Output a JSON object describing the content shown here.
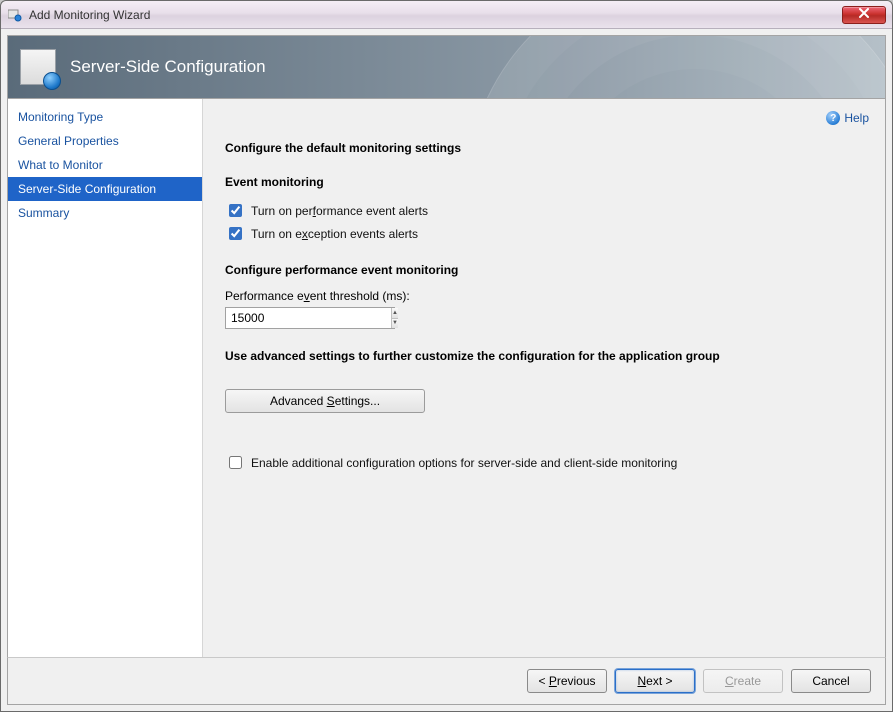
{
  "window": {
    "title": "Add Monitoring Wizard"
  },
  "banner": {
    "heading": "Server-Side Configuration"
  },
  "help": {
    "label": "Help"
  },
  "nav": {
    "items": [
      {
        "label": "Monitoring Type"
      },
      {
        "label": "General Properties"
      },
      {
        "label": "What to Monitor"
      },
      {
        "label": "Server-Side Configuration"
      },
      {
        "label": "Summary"
      }
    ],
    "activeIndex": 3
  },
  "content": {
    "pageHeading": "Configure the default monitoring settings",
    "eventMonitoring": {
      "heading": "Event monitoring",
      "perfAlerts": {
        "label_pre": "Turn on per",
        "label_u": "f",
        "label_post": "ormance event alerts",
        "checked": true
      },
      "excAlerts": {
        "label_pre": "Turn on e",
        "label_u": "x",
        "label_post": "ception events alerts",
        "checked": true
      }
    },
    "perfConfig": {
      "heading": "Configure performance event monitoring",
      "thresholdLabel_pre": "Performance e",
      "thresholdLabel_u": "v",
      "thresholdLabel_post": "ent threshold (ms):",
      "thresholdValue": "15000"
    },
    "advanced": {
      "heading": "Use advanced settings to further customize the configuration for the application group",
      "buttonLabel_pre": "Advanced ",
      "buttonLabel_u": "S",
      "buttonLabel_post": "ettings..."
    },
    "enableExtra": {
      "label": "Enable additional configuration options for server-side and client-side monitoring",
      "checked": false
    }
  },
  "footer": {
    "previous_pre": "< ",
    "previous_u": "P",
    "previous_post": "revious",
    "next_pre": "",
    "next_u": "N",
    "next_post": "ext >",
    "create_label": "Create",
    "cancel_label": "Cancel"
  }
}
